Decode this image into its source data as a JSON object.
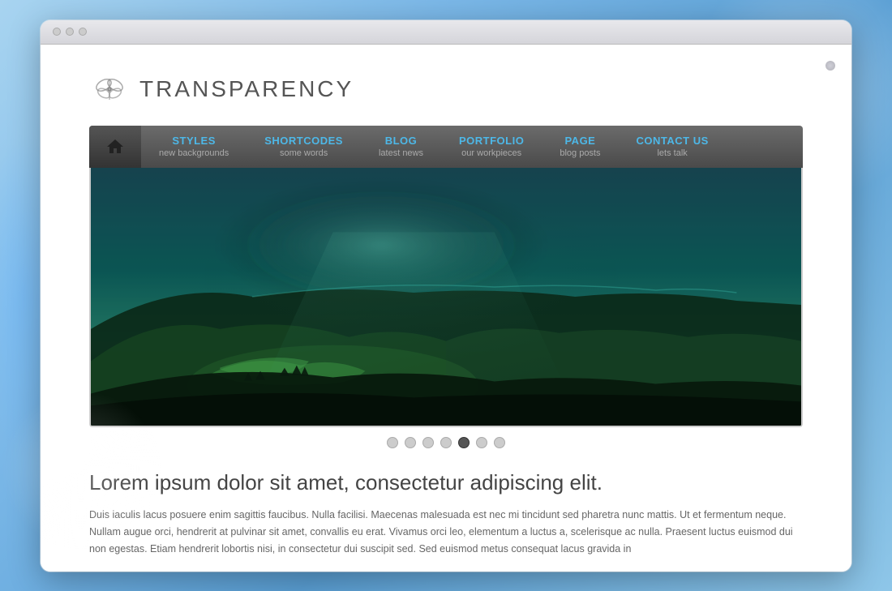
{
  "site": {
    "title": "TRANSPARENCY",
    "logo_alt": "Transparency logo"
  },
  "nav": {
    "home_label": "Home",
    "items": [
      {
        "title": "STYLES",
        "subtitle": "new backgrounds"
      },
      {
        "title": "SHORTCODES",
        "subtitle": "some words"
      },
      {
        "title": "BLOG",
        "subtitle": "latest news"
      },
      {
        "title": "PORTFOLIO",
        "subtitle": "our workpieces"
      },
      {
        "title": "PAGE",
        "subtitle": "blog posts"
      },
      {
        "title": "CONTACT US",
        "subtitle": "lets talk"
      }
    ]
  },
  "slider": {
    "dots": [
      1,
      2,
      3,
      4,
      5,
      6,
      7
    ],
    "active_dot": 5
  },
  "content": {
    "heading": "Lorem ipsum dolor sit amet, consectetur adipiscing elit.",
    "body": "Duis iaculis lacus posuere enim sagittis faucibus. Nulla facilisi. Maecenas malesuada est nec mi tincidunt sed pharetra nunc mattis. Ut et fermentum neque. Nullam augue orci, hendrerit at pulvinar sit amet, convallis eu erat. Vivamus orci leo, elementum a luctus a, scelerisque ac nulla. Praesent luctus euismod dui non egestas. Etiam hendrerit lobortis nisi, in consectetur dui suscipit sed. Sed euismod metus consequat lacus gravida in"
  },
  "colors": {
    "nav_accent": "#4db8e8",
    "nav_bg": "#4a4a4a",
    "body_text": "#666666"
  }
}
